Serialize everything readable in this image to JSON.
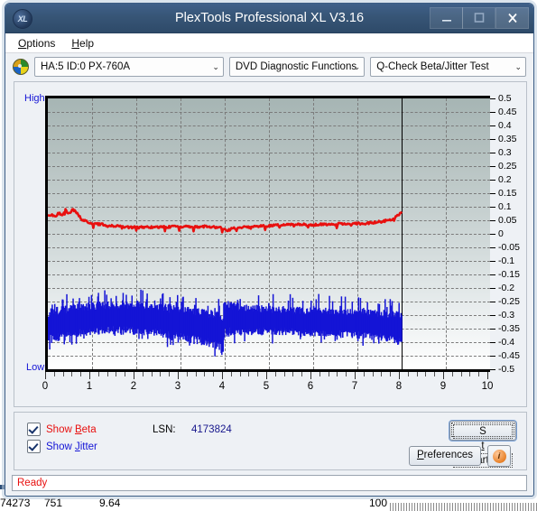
{
  "window": {
    "title": "PlexTools Professional XL V3.16",
    "app_icon": "disc-icon",
    "app_icon_text": "XL",
    "buttons": {
      "minimize": "minimize-icon",
      "maximize": "maximize-icon",
      "close": "close-icon"
    }
  },
  "menu": {
    "items": [
      {
        "label": "Options",
        "accel": "O"
      },
      {
        "label": "Help",
        "accel": "H"
      }
    ]
  },
  "toolbar": {
    "drive_icon": "optical-disc-icon",
    "drive": "HA:5 ID:0  PX-760A",
    "function": "DVD Diagnostic Functions",
    "test": "Q-Check Beta/Jitter Test",
    "arrow": "⌄"
  },
  "chart_panel": {
    "high_label": "High",
    "low_label": "Low"
  },
  "controls": {
    "show_beta": {
      "label_pre": "Show ",
      "label_accel": "B",
      "label_post": "eta",
      "checked": true
    },
    "show_jitter": {
      "label_pre": "Show ",
      "label_accel": "J",
      "label_post": "itter",
      "checked": true
    },
    "lsn_label": "LSN:",
    "lsn_value": "4173824",
    "start": {
      "pre": "S",
      "accel": "t",
      "post": "art"
    },
    "preferences": {
      "pre": "",
      "accel": "P",
      "post": "references"
    },
    "info_button": "info-icon",
    "info_glyph": "i"
  },
  "statusbar": {
    "text": "Ready"
  },
  "background_app": {
    "values": [
      "74273",
      "751",
      "9.64",
      "100"
    ]
  },
  "colors": {
    "beta": "#e8100f",
    "jitter": "#1414d6",
    "titlebar": "#375576",
    "plot_top": "#a6b5b4",
    "plot_bottom": "#ffffff",
    "grid": "#7b7b7b",
    "status_text": "#e8100f"
  },
  "chart_data": {
    "type": "line",
    "title": "Q-Check Beta/Jitter Test",
    "xlabel": "",
    "ylabel": "",
    "xlim": [
      0,
      10
    ],
    "ylim": [
      -0.5,
      0.5
    ],
    "grid": true,
    "legend": "checkboxes",
    "x_ticks": [
      0,
      1,
      2,
      3,
      4,
      5,
      6,
      7,
      8,
      9,
      10
    ],
    "y_ticks": [
      0.5,
      0.45,
      0.4,
      0.35,
      0.3,
      0.25,
      0.2,
      0.15,
      0.1,
      0.05,
      0,
      -0.05,
      -0.1,
      -0.15,
      -0.2,
      -0.25,
      -0.3,
      -0.35,
      -0.4,
      -0.45,
      -0.5
    ],
    "data_end_x": 8,
    "layer_break_x": 4,
    "series": [
      {
        "name": "Beta",
        "color": "#e8100f",
        "type": "line",
        "x": [
          0.0,
          0.08,
          0.16,
          0.24,
          0.32,
          0.4,
          0.48,
          0.56,
          0.64,
          0.72,
          0.8,
          0.9,
          1.0,
          1.15,
          1.3,
          1.45,
          1.6,
          1.75,
          1.9,
          2.05,
          2.2,
          2.35,
          2.5,
          2.65,
          2.8,
          2.95,
          3.1,
          3.25,
          3.4,
          3.55,
          3.7,
          3.85,
          3.95,
          4.0,
          4.05,
          4.2,
          4.4,
          4.6,
          4.8,
          5.0,
          5.25,
          5.5,
          5.75,
          6.0,
          6.25,
          6.5,
          6.75,
          7.0,
          7.25,
          7.5,
          7.7,
          7.85,
          7.95,
          8.0
        ],
        "y": [
          0.068,
          0.072,
          0.062,
          0.078,
          0.07,
          0.088,
          0.074,
          0.09,
          0.082,
          0.062,
          0.05,
          0.044,
          0.04,
          0.036,
          0.033,
          0.03,
          0.028,
          0.026,
          0.024,
          0.024,
          0.026,
          0.025,
          0.024,
          0.025,
          0.026,
          0.027,
          0.026,
          0.027,
          0.026,
          0.027,
          0.026,
          0.024,
          0.02,
          0.016,
          0.012,
          0.02,
          0.024,
          0.026,
          0.028,
          0.03,
          0.032,
          0.033,
          0.034,
          0.034,
          0.035,
          0.036,
          0.037,
          0.038,
          0.04,
          0.044,
          0.05,
          0.06,
          0.072,
          0.08
        ]
      },
      {
        "name": "Jitter",
        "color": "#1414d6",
        "type": "band",
        "x": [
          0.0,
          0.2,
          0.4,
          0.6,
          0.8,
          1.0,
          1.2,
          1.4,
          1.6,
          1.8,
          2.0,
          2.2,
          2.4,
          2.6,
          2.8,
          3.0,
          3.2,
          3.4,
          3.6,
          3.8,
          3.95,
          4.0,
          4.05,
          4.2,
          4.4,
          4.6,
          4.8,
          5.0,
          5.2,
          5.4,
          5.6,
          5.8,
          6.0,
          6.2,
          6.4,
          6.6,
          6.8,
          7.0,
          7.2,
          7.4,
          7.6,
          7.8,
          7.95,
          8.0
        ],
        "upper": [
          -0.28,
          -0.272,
          -0.268,
          -0.265,
          -0.262,
          -0.258,
          -0.255,
          -0.252,
          -0.25,
          -0.25,
          -0.252,
          -0.255,
          -0.258,
          -0.262,
          -0.266,
          -0.27,
          -0.274,
          -0.278,
          -0.284,
          -0.29,
          -0.298,
          -0.25,
          -0.252,
          -0.258,
          -0.262,
          -0.266,
          -0.268,
          -0.27,
          -0.272,
          -0.272,
          -0.274,
          -0.275,
          -0.276,
          -0.277,
          -0.278,
          -0.279,
          -0.28,
          -0.281,
          -0.282,
          -0.284,
          -0.286,
          -0.288,
          -0.29,
          -0.292
        ],
        "lower": [
          -0.4,
          -0.396,
          -0.392,
          -0.378,
          -0.372,
          -0.37,
          -0.368,
          -0.366,
          -0.366,
          -0.368,
          -0.37,
          -0.372,
          -0.376,
          -0.38,
          -0.386,
          -0.392,
          -0.398,
          -0.404,
          -0.412,
          -0.42,
          -0.43,
          -0.378,
          -0.374,
          -0.372,
          -0.37,
          -0.369,
          -0.368,
          -0.368,
          -0.369,
          -0.37,
          -0.371,
          -0.372,
          -0.374,
          -0.375,
          -0.376,
          -0.378,
          -0.38,
          -0.382,
          -0.384,
          -0.388,
          -0.392,
          -0.398,
          -0.406,
          -0.412
        ]
      }
    ]
  }
}
